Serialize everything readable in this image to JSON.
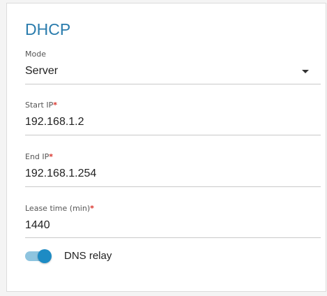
{
  "dhcp": {
    "title": "DHCP",
    "mode": {
      "label": "Mode",
      "value": "Server"
    },
    "start_ip": {
      "label": "Start IP",
      "required_mark": "*",
      "value": "192.168.1.2"
    },
    "end_ip": {
      "label": "End IP",
      "required_mark": "*",
      "value": "192.168.1.254"
    },
    "lease_time": {
      "label": "Lease time (min)",
      "required_mark": "*",
      "value": "1440"
    },
    "dns_relay": {
      "label": "DNS relay",
      "enabled": true
    }
  },
  "colors": {
    "title": "#2a7cad",
    "required": "#d9332b",
    "toggle_thumb": "#1d8bc4",
    "toggle_track": "#8ec4df"
  },
  "icons": {
    "dropdown": "caret-down-icon"
  }
}
